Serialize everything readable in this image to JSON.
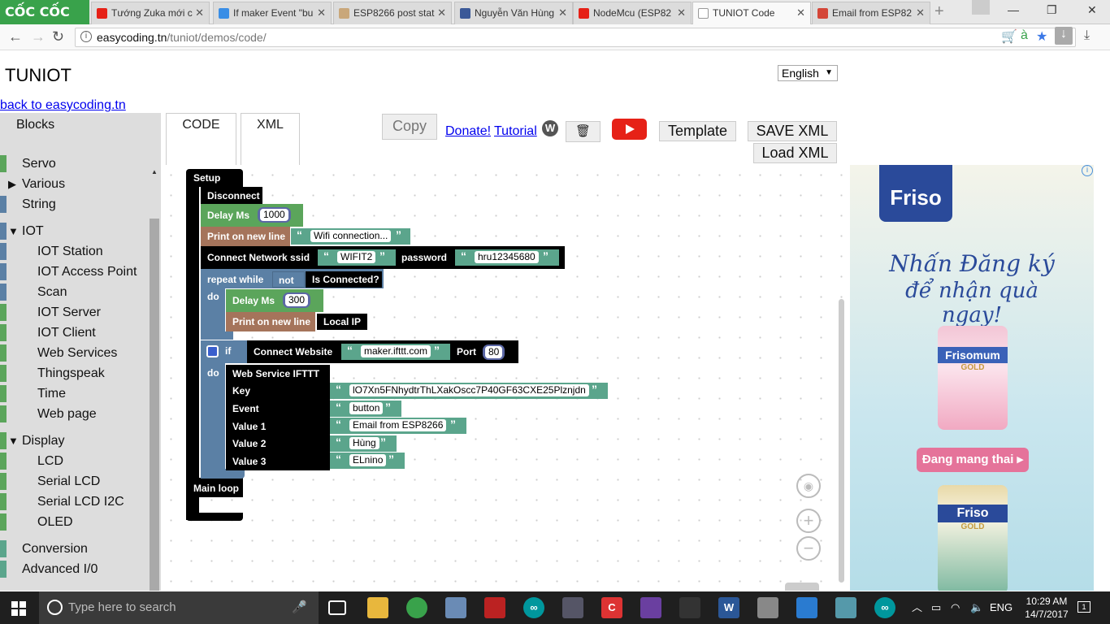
{
  "browser": {
    "brand": "CỐC CỐC",
    "tabs": [
      {
        "title": "Tướng Zuka mới c",
        "icon_color": "#e62117"
      },
      {
        "title": "If maker Event \"bu",
        "icon_color": "#3a8ee6"
      },
      {
        "title": "ESP8266 post stat",
        "icon_color": "#c9a77a"
      },
      {
        "title": "Nguyễn Văn Hùng",
        "icon_color": "#3b5998"
      },
      {
        "title": "NodeMcu (ESP82",
        "icon_color": "#e62117"
      },
      {
        "title": "TUNIOT Code",
        "icon_color": "#ffffff"
      },
      {
        "title": "Email from ESP82",
        "icon_color": "#d44638"
      }
    ],
    "url_host": "easycoding.tn",
    "url_path": "/tuniot/demos/code/",
    "window_controls": [
      "—",
      "❐",
      "✕"
    ]
  },
  "page": {
    "site_title": "TUNIOT",
    "language": "English",
    "back_link": "back to easycoding.tn",
    "tab_code": "CODE",
    "tab_xml": "XML",
    "copy_label": "Copy",
    "donate_label": "Donate!",
    "tutorial_label": "Tutorial",
    "trash_glyph": "🗑",
    "template_label": "Template",
    "save_xml_label": "SAVE XML",
    "load_xml_label": "Load XML"
  },
  "toolbox": {
    "header": "Blocks",
    "items": [
      {
        "label": "Servo",
        "color": "#5ba55b",
        "indent": 1,
        "expand": ""
      },
      {
        "label": "Various",
        "color": "#5ba55b",
        "indent": 1,
        "expand": "▶"
      },
      {
        "label": "String",
        "color": "#5b80a5",
        "indent": 1,
        "expand": ""
      },
      {
        "label": "IOT",
        "color": "#5b80a5",
        "indent": 1,
        "expand": "▼"
      },
      {
        "label": "IOT Station",
        "color": "#5b80a5",
        "indent": 2,
        "expand": ""
      },
      {
        "label": "IOT Access Point",
        "color": "#5b80a5",
        "indent": 2,
        "expand": ""
      },
      {
        "label": "Scan",
        "color": "#5b80a5",
        "indent": 2,
        "expand": ""
      },
      {
        "label": "IOT Server",
        "color": "#5ba55b",
        "indent": 2,
        "expand": ""
      },
      {
        "label": "IOT Client",
        "color": "#5ba55b",
        "indent": 2,
        "expand": ""
      },
      {
        "label": "Web Services",
        "color": "#5ba55b",
        "indent": 2,
        "expand": ""
      },
      {
        "label": "Thingspeak",
        "color": "#5ba55b",
        "indent": 2,
        "expand": ""
      },
      {
        "label": "Time",
        "color": "#5ba55b",
        "indent": 2,
        "expand": ""
      },
      {
        "label": "Web page",
        "color": "#5ba55b",
        "indent": 2,
        "expand": ""
      },
      {
        "label": "Display",
        "color": "#5ba55b",
        "indent": 1,
        "expand": "▼"
      },
      {
        "label": "LCD",
        "color": "#5ba55b",
        "indent": 2,
        "expand": ""
      },
      {
        "label": "Serial LCD",
        "color": "#5ba55b",
        "indent": 2,
        "expand": ""
      },
      {
        "label": "Serial LCD I2C",
        "color": "#5ba55b",
        "indent": 2,
        "expand": ""
      },
      {
        "label": "OLED",
        "color": "#5ba55b",
        "indent": 2,
        "expand": ""
      },
      {
        "label": "Conversion",
        "color": "#5ba58c",
        "indent": 1,
        "expand": ""
      },
      {
        "label": "Advanced I/0",
        "color": "#5ba58c",
        "indent": 1,
        "expand": ""
      }
    ]
  },
  "blocks": {
    "setup": "Setup",
    "disconnect": "Disconnect",
    "delay1_label": "Delay Ms",
    "delay1_value": "1000",
    "print1_label": "Print on new line",
    "print1_value": "Wifi connection...",
    "connect_label": "Connect Network  ssid",
    "ssid_value": "WIFIT2",
    "password_label": "password",
    "password_value": "hru12345680",
    "repeat_label": "repeat while",
    "not_label": "not",
    "is_connected": "Is Connected?",
    "do_label": "do",
    "delay2_label": "Delay Ms",
    "delay2_value": "300",
    "print2_label": "Print on new line",
    "local_ip": "Local IP",
    "if_label": "if",
    "connect_website_label": "Connect  Website",
    "website_value": "maker.ifttt.com",
    "port_label": "Port",
    "port_value": "80",
    "do2_label": "do",
    "ifttt_label": "Web Service IFTTT",
    "key_label": "Key",
    "key_value": "lO7Xn5FNhydtrThLXakOscc7P40GF63CXE25Plznjdn",
    "event_label": "Event",
    "event_value": "button",
    "value1_label": "Value 1",
    "value1_value": "Email from ESP8266",
    "value2_label": "Value 2",
    "value2_value": "Hùng",
    "value3_label": "Value 3",
    "value3_value": "ELnino",
    "main_loop": "Main loop",
    "quote_open": "“",
    "quote_close": "”"
  },
  "ad": {
    "brand": "Friso",
    "headline1": "Nhấn Đăng ký",
    "headline2": "để nhận quà ngay!",
    "can1_brand": "Frisomum",
    "can1_sub": "GOLD",
    "cta": "Đang mang thai ▸",
    "can2_brand": "Friso",
    "can2_sub": "GOLD"
  },
  "taskbar": {
    "search_placeholder": "Type here to search",
    "language": "ENG",
    "time": "10:29 AM",
    "date": "14/7/2017",
    "notification_count": "1"
  }
}
